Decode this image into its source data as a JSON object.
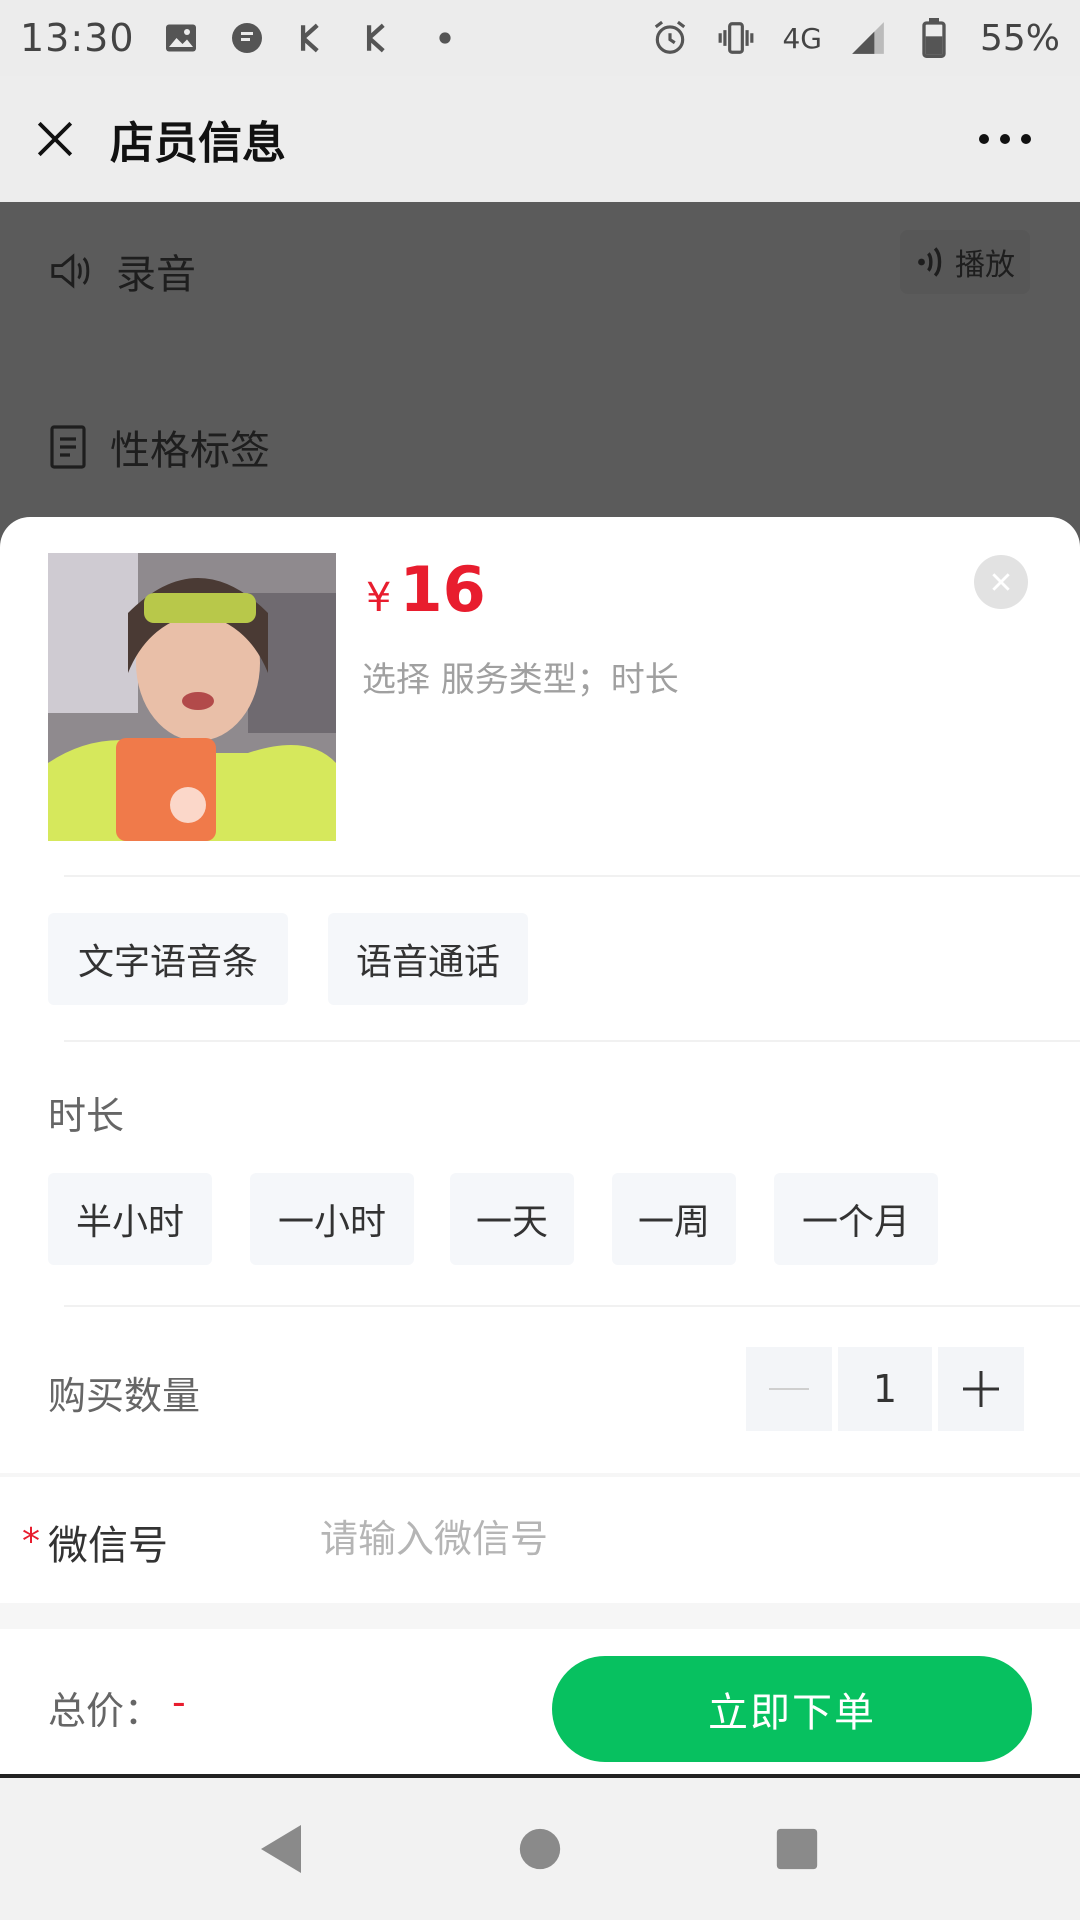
{
  "status_bar": {
    "time": "13:30",
    "network": "4G",
    "battery": "55%"
  },
  "app_bar": {
    "title": "店员信息"
  },
  "background": {
    "recording_label": "录音",
    "play_label": "播放",
    "personality_label": "性格标签"
  },
  "sheet": {
    "currency_symbol": "¥",
    "price": "16",
    "selection_hint": "选择 服务类型；时长",
    "service_types": [
      "文字语音条",
      "语音通话"
    ],
    "duration_label": "时长",
    "durations": [
      "半小时",
      "一小时",
      "一天",
      "一周",
      "一个月"
    ],
    "quantity_label": "购买数量",
    "quantity": "1",
    "wechat": {
      "required_mark": "*",
      "label": "微信号",
      "placeholder": "请输入微信号",
      "value": ""
    }
  },
  "footer": {
    "total_label": "总价：",
    "total_value": "-",
    "order_button": "立即下单"
  },
  "colors": {
    "price_red": "#e81d2e",
    "wechat_green": "#07c160",
    "chip_bg": "#f5f7fa"
  }
}
